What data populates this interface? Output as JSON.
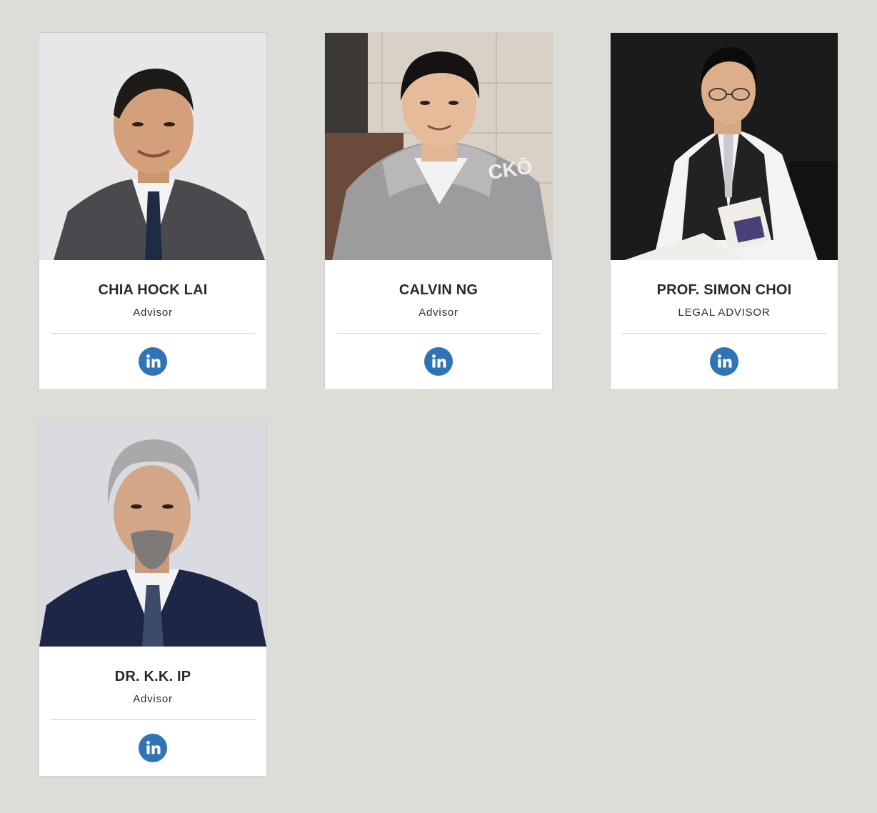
{
  "advisors": [
    {
      "name": "CHIA HOCK LAI",
      "role": "Advisor",
      "icon": "linkedin-icon"
    },
    {
      "name": "CALVIN NG",
      "role": "Advisor",
      "icon": "linkedin-icon"
    },
    {
      "name": "PROF. SIMON CHOI",
      "role": "LEGAL ADVISOR",
      "icon": "linkedin-icon"
    },
    {
      "name": "DR. K.K. IP",
      "role": "Advisor",
      "icon": "linkedin-icon"
    }
  ],
  "colors": {
    "background": "#dcddd7",
    "card": "#ffffff",
    "linkedin": "#2f74b5",
    "text": "#252a2e"
  }
}
